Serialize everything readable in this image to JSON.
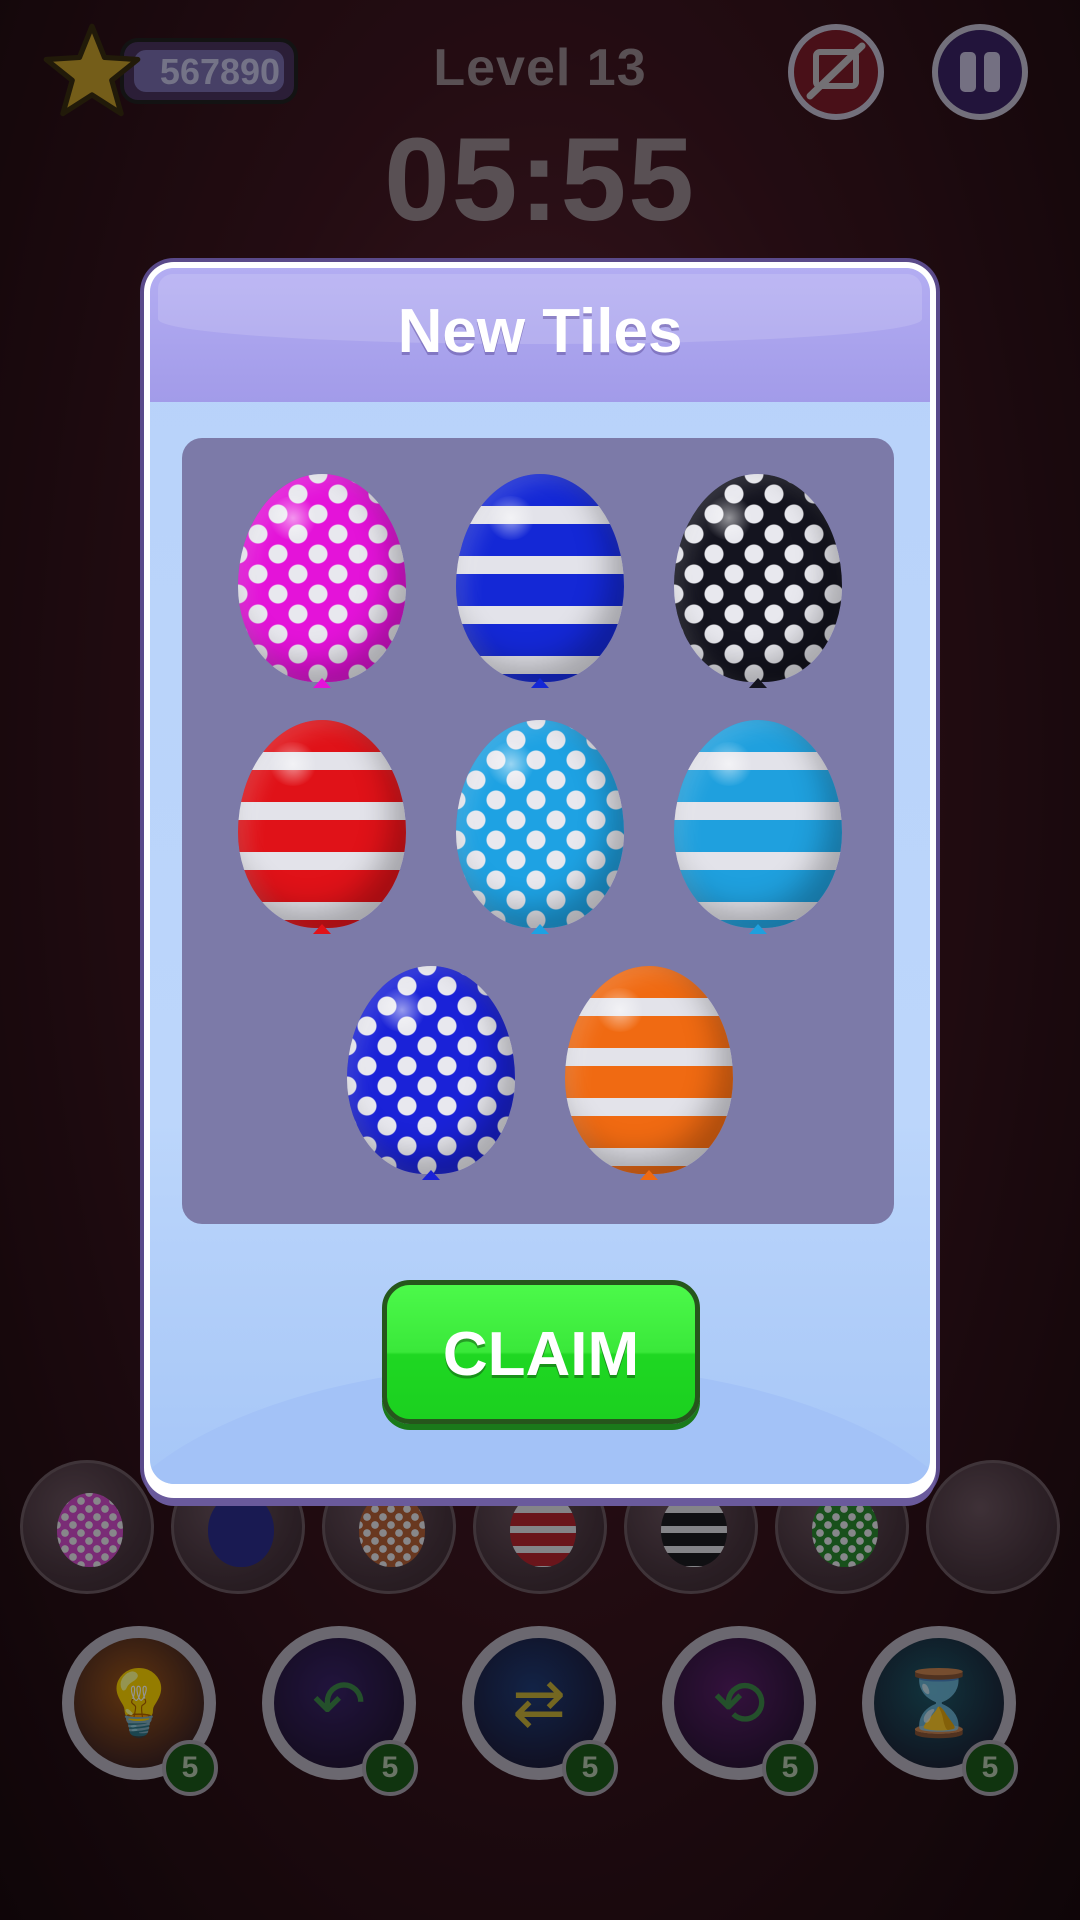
{
  "hud": {
    "score": "567890",
    "level": "Level 13",
    "timer": "05:55"
  },
  "dialog": {
    "title": "New Tiles",
    "claim_label": "CLAIM",
    "tiles": [
      {
        "color": "#e413d9",
        "pattern": "dots"
      },
      {
        "color": "#1428d6",
        "pattern": "stripes"
      },
      {
        "color": "#14141f",
        "pattern": "dots"
      },
      {
        "color": "#e01218",
        "pattern": "stripes"
      },
      {
        "color": "#1ea2e3",
        "pattern": "dots"
      },
      {
        "color": "#1fa0de",
        "pattern": "stripes"
      },
      {
        "color": "#1a22d8",
        "pattern": "dots"
      },
      {
        "color": "#f06a12",
        "pattern": "stripes"
      }
    ]
  },
  "tray": [
    {
      "color": "#d34ccb",
      "pattern": "dots"
    },
    {
      "color": "#2b2d8e",
      "pattern": "solid"
    },
    {
      "color": "#b56137",
      "pattern": "dots"
    },
    {
      "color": "#b72530",
      "pattern": "stripes"
    },
    {
      "color": "#1c1c22",
      "pattern": "stripes"
    },
    {
      "color": "#2a8a30",
      "pattern": "dots"
    },
    {
      "color": "",
      "pattern": "empty"
    }
  ],
  "powerups": [
    {
      "name": "hint",
      "icon": "lightbulb-icon",
      "face_color": "#a4591a",
      "count": "5"
    },
    {
      "name": "undo",
      "icon": "undo-arrow-icon",
      "face_color": "#3a236a",
      "count": "5"
    },
    {
      "name": "shuffle",
      "icon": "shuffle-arrows-icon",
      "face_color": "#1f3d7a",
      "count": "5"
    },
    {
      "name": "swap",
      "icon": "swap-arrows-icon",
      "face_color": "#5a1f6a",
      "count": "5"
    },
    {
      "name": "freeze",
      "icon": "hourglass-snowflake-icon",
      "face_color": "#1e5a6a",
      "count": "5"
    }
  ]
}
